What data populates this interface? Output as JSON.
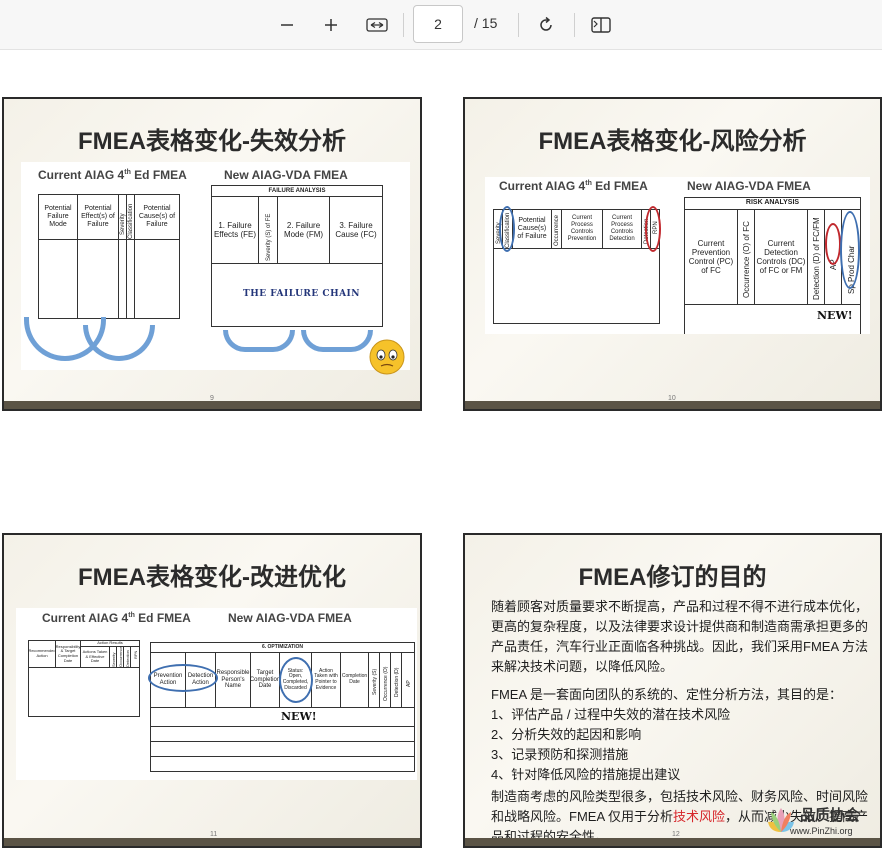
{
  "toolbar": {
    "zoom_out": "−",
    "zoom_in": "+",
    "page_value": "2",
    "page_total": "/ 15"
  },
  "slides": [
    {
      "title": "FMEA表格变化-失效分析",
      "page_num": "9",
      "current_label": "Current AIAG 4",
      "current_sup": "th",
      "current_suffix": " Ed FMEA",
      "new_label": "New AIAG-VDA FMEA",
      "old_cols": [
        "Potential Failure Mode",
        "Potential Effect(s) of Failure",
        "Severity",
        "Classification",
        "Potential Cause(s) of Failure"
      ],
      "section": "FAILURE ANALYSIS",
      "new_cols": [
        "1. Failure Effects (FE)",
        "Severity (S) of FE",
        "2. Failure Mode (FM)",
        "3. Failure Cause (FC)"
      ],
      "banner": "THE FAILURE CHAIN"
    },
    {
      "title": "FMEA表格变化-风险分析",
      "page_num": "10",
      "current_label": "Current AIAG 4",
      "current_sup": "th",
      "current_suffix": " Ed FMEA",
      "new_label": "New AIAG-VDA FMEA",
      "old_cols": [
        "Severity",
        "Classification",
        "Potential Cause(s) of Failure",
        "Occurrence",
        "Current Process Controls Prevention",
        "Current Process Controls Detection",
        "Detection",
        "RPN"
      ],
      "section": "RISK ANALYSIS",
      "new_cols": [
        "Current Prevention Control (PC) of FC",
        "Occurrence (O) of FC",
        "Current Detection Controls (DC) of FC or FM",
        "Detection (D) of FC/FM",
        "AP",
        "Sp Prod Char"
      ],
      "new_badge": "NEW!"
    },
    {
      "title": "FMEA表格变化-改进优化",
      "page_num": "11",
      "current_label": "Current AIAG 4",
      "current_sup": "th",
      "current_suffix": " Ed FMEA",
      "new_label": "New AIAG-VDA FMEA",
      "old_cols": [
        "Recommended Action",
        "Responsibility & Target Completion Date",
        "Action Results",
        "Actions Taken & Effective Date",
        "Severity",
        "Occurrence",
        "Detection",
        "RPN"
      ],
      "section": "6. OPTIMIZATION",
      "new_cols": [
        "Prevention Action",
        "Detection Action",
        "Responsible Person's Name",
        "Target Completion Date",
        "Status: Open, Completed, Discarded",
        "Action Taken with Pointer to Evidence",
        "Completion Date",
        "Severity (S)",
        "Occurrence (O)",
        "Detection (D)",
        "AP"
      ],
      "new_badge": "NEW!"
    },
    {
      "title": "FMEA修订的目的",
      "page_num": "12",
      "para1": "随着顾客对质量要求不断提高，产品和过程不得不进行成本优化，更高的复杂程度，以及法律要求设计提供商和制造商需承担更多的产品责任，汽车行业正面临各种挑战。因此，我们采用FMEA 方法来解决技术问题，以降低风险。",
      "para2": "FMEA 是一套面向团队的系统的、定性分析方法，其目的是：",
      "items": [
        "1、评估产品 / 过程中失效的潜在技术风险",
        "2、分析失效的起因和影响",
        "3、记录预防和探测措施",
        "4、针对降低风险的措施提出建议"
      ],
      "para3_a": "制造商考虑的风险类型很多，包括技术风险、财务风险、时间风险和战略风险。FMEA 仅用于分析",
      "para3_red": "技术风险",
      "para3_b": "，从而减少失效、提高产品和过程的安全性。",
      "logo_cn": "品质协会",
      "logo_url": "www.PinZhi.org"
    }
  ]
}
